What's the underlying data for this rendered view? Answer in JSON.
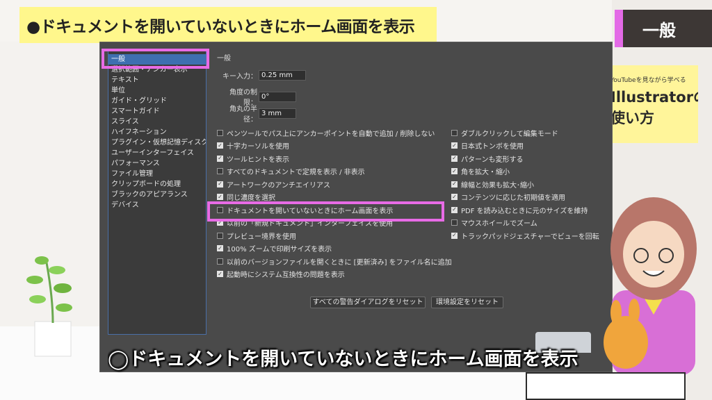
{
  "top_caption": "●ドキュメントを開いていないときにホーム画面を表示",
  "section_label": "一般",
  "card": {
    "tagline": "YouTubeを見ながら学べる",
    "title_line1": "Illustratorの",
    "title_line2": "使い方"
  },
  "sidebar": {
    "items": [
      "一般",
      "選択範囲・アンカー表示",
      "テキスト",
      "単位",
      "ガイド・グリッド",
      "スマートガイド",
      "スライス",
      "ハイフネーション",
      "プラグイン・仮想記憶ディスク",
      "ユーザーインターフェイス",
      "パフォーマンス",
      "ファイル管理",
      "クリップボードの処理",
      "ブラックのアピアランス",
      "デバイス"
    ]
  },
  "panel_title": "一般",
  "fields": [
    {
      "label": "キー入力：",
      "value": "0.25 mm"
    },
    {
      "label": "角度の制限：",
      "value": "0°"
    },
    {
      "label": "角丸の半径：",
      "value": "3 mm"
    }
  ],
  "options_left": [
    {
      "label": "ペンツールでパス上にアンカーポイントを自動で追加 / 削除しない",
      "checked": false
    },
    {
      "label": "十字カーソルを使用",
      "checked": true
    },
    {
      "label": "ツールヒントを表示",
      "checked": true
    },
    {
      "label": "すべてのドキュメントで定規を表示 / 非表示",
      "checked": false
    },
    {
      "label": "アートワークのアンチエイリアス",
      "checked": true
    },
    {
      "label": "同じ濃度を選択",
      "checked": true
    },
    {
      "label": "ドキュメントを開いていないときにホーム画面を表示",
      "checked": false
    },
    {
      "label": "以前の「新規ドキュメント」インターフェイスを使用",
      "checked": true
    },
    {
      "label": "プレビュー境界を使用",
      "checked": false
    },
    {
      "label": "100% ズームで印刷サイズを表示",
      "checked": true
    },
    {
      "label": "以前のバージョンファイルを開くときに [更新済み] をファイル名に追加",
      "checked": false
    },
    {
      "label": "起動時にシステム互換性の問題を表示",
      "checked": true
    }
  ],
  "options_right": [
    {
      "label": "ダブルクリックして編集モード",
      "checked": false
    },
    {
      "label": "日本式トンボを使用",
      "checked": true
    },
    {
      "label": "パターンも変形する",
      "checked": true
    },
    {
      "label": "角を拡大・縮小",
      "checked": true
    },
    {
      "label": "線幅と効果も拡大･縮小",
      "checked": true
    },
    {
      "label": "コンテンツに応じた初期値を適用",
      "checked": true
    },
    {
      "label": "PDF を読み込むときに元のサイズを維持",
      "checked": true
    },
    {
      "label": "マウスホイールでズーム",
      "checked": false
    },
    {
      "label": "トラックパッドジェスチャーでビューを回転",
      "checked": true
    }
  ],
  "buttons": {
    "reset_warnings": "すべての警告ダイアログをリセット",
    "reset_prefs": "環境設定をリセット"
  },
  "bottom_caption": "◯ドキュメントを開いていないときにホーム画面を表示",
  "colors": {
    "highlight": "#e86be6",
    "caption_bg": "#fff78c",
    "dialog_bg": "#4a4a4a",
    "selection": "#3e6fb0"
  }
}
